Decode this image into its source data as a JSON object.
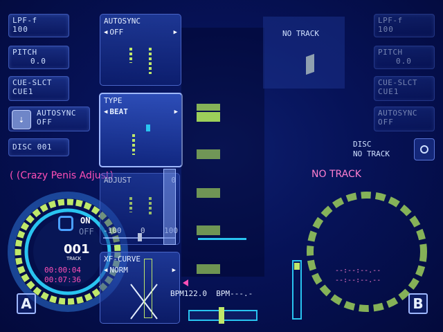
{
  "left": {
    "lpf_label": "LPF-f",
    "lpf_value": "100",
    "pitch_label": "PITCH",
    "pitch_value": "0.0",
    "cue_label": "CUE-SLCT",
    "cue_value": "CUE1",
    "autosync_label": "AUTOSYNC",
    "autosync_value": "OFF",
    "disc_label": "DISC 001",
    "track_title": "( (Crazy Penis Adjust)",
    "toggle_on": "ON",
    "toggle_off": "OFF",
    "track_number": "001",
    "track_label": "TRACK",
    "time_elapsed": "00:00:04",
    "time_remain": "00:07:36",
    "deck_letter": "A"
  },
  "center": {
    "autosync_title": "AUTOSYNC",
    "autosync_value": "OFF",
    "type_title": "TYPE",
    "type_value": "BEAT",
    "adjust_title": "ADJUST",
    "adjust_value": "0",
    "adjust_min": "-100",
    "adjust_mid": "0",
    "adjust_max": "100",
    "xf_title": "XF-CURVE",
    "xf_value": "NORM",
    "bpm_text": "BPM122.0  BPM---.-"
  },
  "right": {
    "no_track_top": "NO TRACK",
    "lpf_label": "LPF-f",
    "lpf_value": "100",
    "pitch_label": "PITCH",
    "pitch_value": "0.0",
    "cue_label": "CUE-SLCT",
    "cue_value": "CUE1",
    "autosync_label": "AUTOSYNC",
    "autosync_value": "OFF",
    "disc_label": "DISC",
    "disc_value": "NO TRACK",
    "no_track_title": "NO TRACK",
    "time_placeholder_1": "--:--:--.--",
    "time_placeholder_2": "--:--:--.--",
    "deck_letter": "B"
  },
  "colors": {
    "accent_green": "#bfe86a",
    "accent_cyan": "#29c4f0",
    "accent_pink": "#ff4fb6",
    "panel_blue": "#2f4fb8"
  }
}
